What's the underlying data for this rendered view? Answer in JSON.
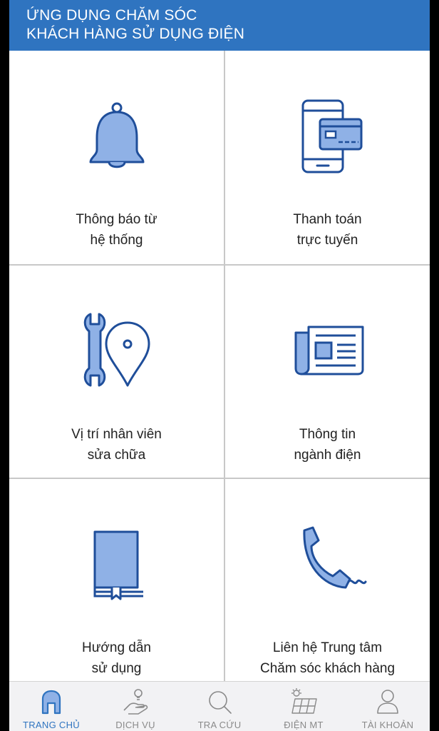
{
  "header": {
    "title_line1": "ỨNG DỤNG CHĂM SÓC",
    "title_line2": "KHÁCH HÀNG SỬ DỤNG ĐIỆN"
  },
  "colors": {
    "brand": "#2f74c0",
    "icon_fill": "#8fb1e6",
    "icon_stroke": "#1f4e9a",
    "tab_inactive": "#8a8a8a"
  },
  "menu": [
    {
      "icon": "bell-icon",
      "line1": "Thông báo từ",
      "line2": "hệ thống"
    },
    {
      "icon": "mobile-payment-icon",
      "line1": "Thanh toán",
      "line2": "trực tuyến"
    },
    {
      "icon": "wrench-location-icon",
      "line1": "Vị trí nhân viên",
      "line2": "sửa chữa"
    },
    {
      "icon": "newspaper-icon",
      "line1": "Thông tin",
      "line2": "ngành điện"
    },
    {
      "icon": "book-icon",
      "line1": "Hướng dẫn",
      "line2": "sử dụng"
    },
    {
      "icon": "phone-icon",
      "line1": "Liên hệ Trung tâm",
      "line2": "Chăm sóc khách hàng"
    }
  ],
  "tabs": [
    {
      "icon": "home-icon",
      "label": "TRANG CHỦ",
      "active": true
    },
    {
      "icon": "hand-lightbulb-icon",
      "label": "DỊCH VỤ",
      "active": false
    },
    {
      "icon": "search-icon",
      "label": "TRA CỨU",
      "active": false
    },
    {
      "icon": "solar-panel-icon",
      "label": "ĐIỆN MT",
      "active": false
    },
    {
      "icon": "user-icon",
      "label": "TÀI KHOẢN",
      "active": false
    }
  ]
}
